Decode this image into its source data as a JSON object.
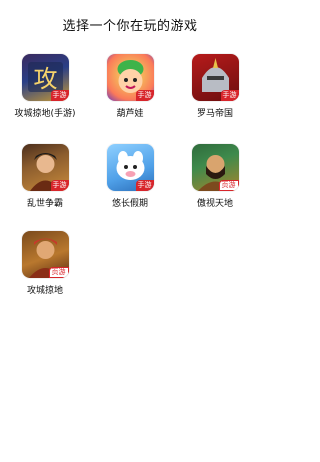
{
  "header": {
    "title": "选择一个你在玩的游戏"
  },
  "games": [
    {
      "name": "攻城掠地(手游)",
      "badge": "手游",
      "badge_type": "mobile",
      "icon": "siege-game-icon"
    },
    {
      "name": "葫芦娃",
      "badge": "手游",
      "badge_type": "mobile",
      "icon": "calabash-boy-game-icon"
    },
    {
      "name": "罗马帝国",
      "badge": "手游",
      "badge_type": "mobile",
      "icon": "roman-empire-game-icon"
    },
    {
      "name": "乱世争霸",
      "badge": "手游",
      "badge_type": "mobile",
      "icon": "chaos-hegemony-game-icon"
    },
    {
      "name": "悠长假期",
      "badge": "手游",
      "badge_type": "mobile",
      "icon": "long-vacation-game-icon"
    },
    {
      "name": "傲视天地",
      "badge": "页游",
      "badge_type": "web",
      "icon": "proud-world-game-icon"
    },
    {
      "name": "攻城掠地",
      "badge": "页游",
      "badge_type": "web",
      "icon": "siege-web-game-icon"
    }
  ],
  "colors": {
    "badge_red": "#d8252b",
    "background": "#ffffff"
  }
}
